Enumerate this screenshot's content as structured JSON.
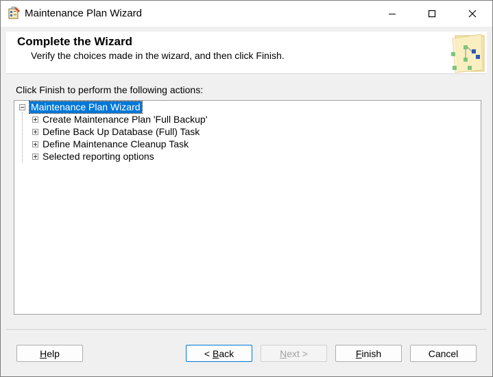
{
  "window": {
    "title": "Maintenance Plan Wizard"
  },
  "header": {
    "title": "Complete the Wizard",
    "subtitle": "Verify the choices made in the wizard, and then click Finish."
  },
  "main": {
    "actions_label": "Click Finish to perform the following actions:",
    "tree": {
      "root": "Maintenance Plan Wizard",
      "children": [
        "Create Maintenance Plan 'Full Backup'",
        "Define Back Up Database (Full) Task",
        "Define Maintenance Cleanup Task",
        "Selected reporting options"
      ]
    }
  },
  "buttons": {
    "help": {
      "mnemonic": "H",
      "rest": "elp"
    },
    "back": {
      "prefix": "< ",
      "mnemonic": "B",
      "rest": "ack"
    },
    "next": {
      "mnemonic": "N",
      "rest": "ext >"
    },
    "finish": {
      "mnemonic": "F",
      "rest": "inish"
    },
    "cancel": "Cancel"
  },
  "colors": {
    "selection": "#0078d7",
    "window_bg": "#f0f0f0",
    "header_bg": "#ffffff"
  },
  "icons": [
    "wizard-app-icon",
    "minimize-icon",
    "maximize-icon",
    "close-icon",
    "wizard-header-art"
  ]
}
